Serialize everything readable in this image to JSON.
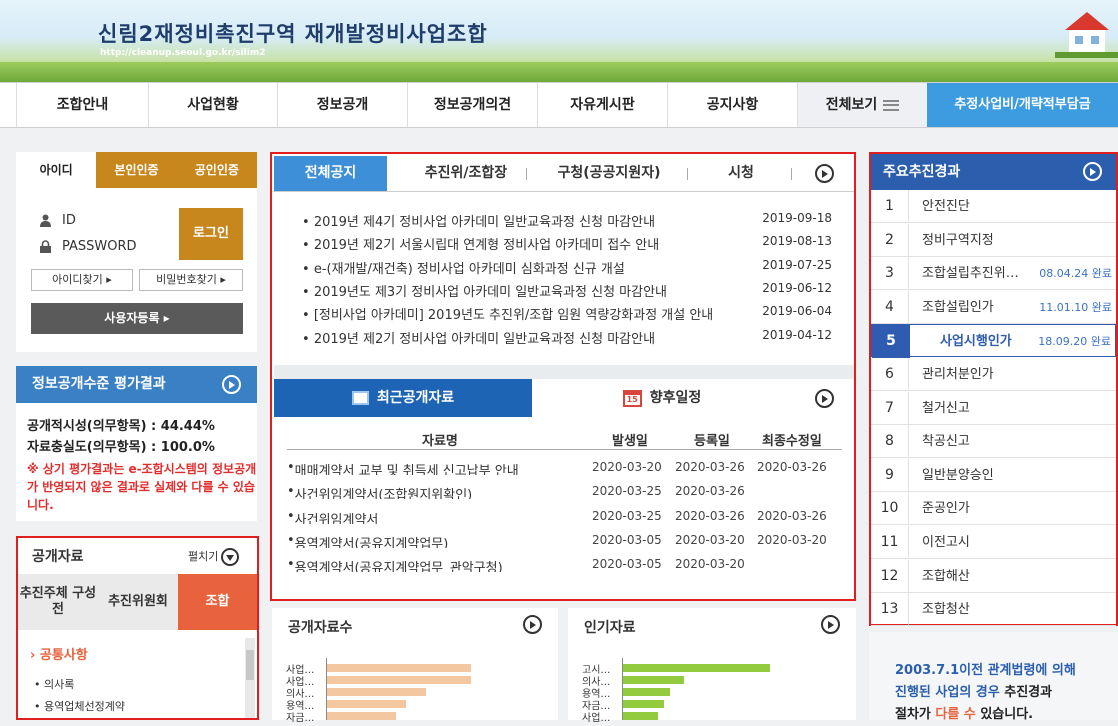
{
  "header": {
    "title": "신림2재정비촉진구역 재개발정비사업조합",
    "url": "http://cleanup.seoul.go.kr/silim2"
  },
  "gnb": {
    "items": [
      "조합안내",
      "사업현황",
      "정보공개",
      "정보공개의견",
      "자유게시판",
      "공지사항"
    ],
    "all_label": "전체보기",
    "blue_label": "추정사업비/개략적부담금"
  },
  "login": {
    "tabs": [
      "아이디",
      "본인인증",
      "공인인증"
    ],
    "id_placeholder": "ID",
    "pw_placeholder": "PASSWORD",
    "login_label": "로그인",
    "find_id": "아이디찾기",
    "find_pw": "비밀번호찾기",
    "signup": "사용자등록"
  },
  "eval": {
    "title": "정보공개수준 평가결과",
    "line1": "공개적시성(의무항목) : 44.44%",
    "line2": "자료충실도(의무항목) : 100.0%",
    "warn": "※ 상기 평가결과는 e-조합시스템의 정보공개가 반영되지 않은 결과로 실제와 다를 수 있습니다."
  },
  "pubdata": {
    "title": "공개자료",
    "fold": "펼치기",
    "tabs": [
      "추진주체 구성 전",
      "추진위원회",
      "조합"
    ],
    "common": "공통사항",
    "items": [
      "의사록",
      "용역업체선정계약"
    ]
  },
  "notice": {
    "tabs": [
      "전체공지",
      "추진위/조합장",
      "구청(공공지원자)",
      "시청"
    ],
    "rows": [
      {
        "title": "2019년 제4기 정비사업 아카데미 일반교육과정 신청 마감안내",
        "date": "2019-09-18"
      },
      {
        "title": "2019년 제2기 서울시립대 연계형 정비사업 아카데미 접수 안내",
        "date": "2019-08-13"
      },
      {
        "title": "e-(재개발/재건축) 정비사업 아카데미 심화과정 신규 개설",
        "date": "2019-07-25"
      },
      {
        "title": "2019년도 제3기 정비사업 아카데미 일반교육과정 신청 마감안내",
        "date": "2019-06-12"
      },
      {
        "title": "[정비사업 아카데미] 2019년도 추진위/조합 임원 역량강화과정 개설 안내",
        "date": "2019-06-04"
      },
      {
        "title": "2019년 제2기 정비사업 아카데미 일반교육과정 신청 마감안내",
        "date": "2019-04-12"
      }
    ]
  },
  "recent": {
    "tabs": [
      "최근공개자료",
      "향후일정"
    ],
    "calendar_day": "15",
    "headers": [
      "자료명",
      "발생일",
      "등록일",
      "최종수정일"
    ],
    "rows": [
      {
        "name": "매매계약서 교부 및 취득세 신고납부 안내",
        "occur": "2020-03-20",
        "reg": "2020-03-26",
        "mod": "2020-03-26"
      },
      {
        "name": "사건위임계약서(조합원지위확인)",
        "occur": "2020-03-25",
        "reg": "2020-03-26",
        "mod": ""
      },
      {
        "name": "사건위임계약서",
        "occur": "2020-03-25",
        "reg": "2020-03-26",
        "mod": "2020-03-26"
      },
      {
        "name": "용역계약서(공유지계약업무)",
        "occur": "2020-03-05",
        "reg": "2020-03-20",
        "mod": "2020-03-20"
      },
      {
        "name": "용역계약서(공유지계약업무_관악구청)",
        "occur": "2020-03-05",
        "reg": "2020-03-20",
        "mod": ""
      }
    ]
  },
  "count_box": {
    "title": "공개자료수",
    "labels": [
      "사업…",
      "사업…",
      "의사…",
      "용역…",
      "자금…"
    ]
  },
  "popular_box": {
    "title": "인기자료",
    "labels": [
      "고시…",
      "의사…",
      "용역…",
      "자금…",
      "사업…"
    ]
  },
  "progress": {
    "title": "주요추진경과",
    "rows": [
      {
        "no": "1",
        "name": "안전진단",
        "date": ""
      },
      {
        "no": "2",
        "name": "정비구역지정",
        "date": ""
      },
      {
        "no": "3",
        "name": "조합설립추진위원회승인",
        "date": "08.04.24 완료"
      },
      {
        "no": "4",
        "name": "조합설립인가",
        "date": "11.01.10 완료"
      },
      {
        "no": "5",
        "name": "사업시행인가",
        "date": "18.09.20 완료"
      },
      {
        "no": "6",
        "name": "관리처분인가",
        "date": ""
      },
      {
        "no": "7",
        "name": "철거신고",
        "date": ""
      },
      {
        "no": "8",
        "name": "착공신고",
        "date": ""
      },
      {
        "no": "9",
        "name": "일반분양승인",
        "date": ""
      },
      {
        "no": "10",
        "name": "준공인가",
        "date": ""
      },
      {
        "no": "11",
        "name": "이전고시",
        "date": ""
      },
      {
        "no": "12",
        "name": "조합해산",
        "date": ""
      },
      {
        "no": "13",
        "name": "조합청산",
        "date": ""
      }
    ]
  },
  "law": {
    "line1": "2003.7.1이전 관계법령에 의해",
    "line2a": "진행된 사업의 경우 ",
    "line2b": "추진경과",
    "line3a": "절차가 ",
    "line3b": "다를 수",
    "line3c": " 있습니다."
  }
}
